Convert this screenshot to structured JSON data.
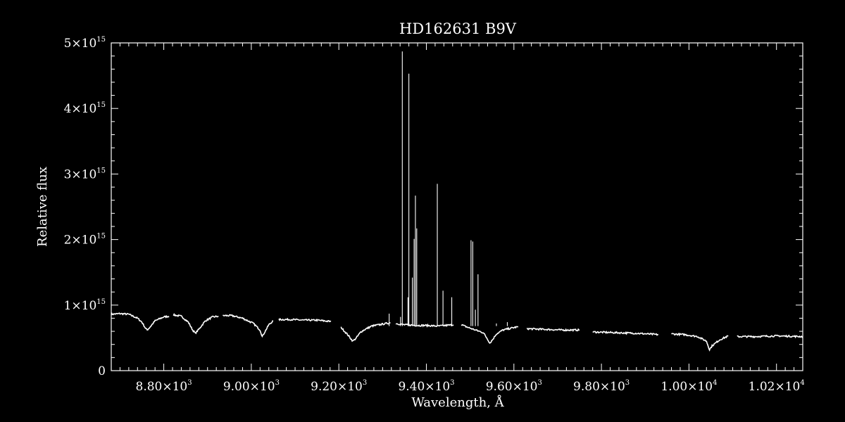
{
  "chart_data": {
    "type": "line",
    "title": "HD162631   B9V",
    "xlabel": "Wavelength, Å",
    "ylabel": "Relative flux",
    "xlim": [
      8680,
      10260
    ],
    "ylim": [
      0,
      5000000000000000.0
    ],
    "grid": false,
    "x_ticks": [
      {
        "value": 8800,
        "mantissa": "8.80×10",
        "exp": "3"
      },
      {
        "value": 9000,
        "mantissa": "9.00×10",
        "exp": "3"
      },
      {
        "value": 9200,
        "mantissa": "9.20×10",
        "exp": "3"
      },
      {
        "value": 9400,
        "mantissa": "9.40×10",
        "exp": "3"
      },
      {
        "value": 9600,
        "mantissa": "9.60×10",
        "exp": "3"
      },
      {
        "value": 9800,
        "mantissa": "9.80×10",
        "exp": "3"
      },
      {
        "value": 10000,
        "mantissa": "1.00×10",
        "exp": "4"
      },
      {
        "value": 10200,
        "mantissa": "1.02×10",
        "exp": "4"
      }
    ],
    "y_ticks": [
      {
        "value": 0,
        "mantissa": "0",
        "exp": ""
      },
      {
        "value": 1000000000000000.0,
        "mantissa": "1×10",
        "exp": "15"
      },
      {
        "value": 2000000000000000.0,
        "mantissa": "2×10",
        "exp": "15"
      },
      {
        "value": 3000000000000000.0,
        "mantissa": "3×10",
        "exp": "15"
      },
      {
        "value": 4000000000000000.0,
        "mantissa": "4×10",
        "exp": "15"
      },
      {
        "value": 5000000000000000.0,
        "mantissa": "5×10",
        "exp": "15"
      }
    ],
    "series": [
      {
        "points": [
          [
            8680,
            0.86
          ],
          [
            8700,
            0.87
          ],
          [
            8720,
            0.86
          ],
          [
            8740,
            0.8
          ],
          [
            8750,
            0.74
          ],
          [
            8758,
            0.65
          ],
          [
            8762,
            0.62
          ],
          [
            8768,
            0.66
          ],
          [
            8780,
            0.76
          ],
          [
            8800,
            0.82
          ],
          [
            8812,
            0.83
          ]
        ]
      },
      {
        "points": [
          [
            8822,
            0.85
          ],
          [
            8840,
            0.83
          ],
          [
            8856,
            0.74
          ],
          [
            8866,
            0.62
          ],
          [
            8872,
            0.57
          ],
          [
            8880,
            0.63
          ],
          [
            8895,
            0.76
          ],
          [
            8912,
            0.82
          ],
          [
            8925,
            0.83
          ]
        ]
      },
      {
        "points": [
          [
            8935,
            0.84
          ],
          [
            8955,
            0.84
          ],
          [
            8980,
            0.8
          ],
          [
            9005,
            0.72
          ],
          [
            9020,
            0.62
          ],
          [
            9025,
            0.52
          ],
          [
            9030,
            0.58
          ],
          [
            9040,
            0.7
          ],
          [
            9050,
            0.76
          ]
        ]
      },
      {
        "points": [
          [
            9063,
            0.78
          ],
          [
            9090,
            0.78
          ],
          [
            9120,
            0.77
          ],
          [
            9150,
            0.77
          ],
          [
            9182,
            0.75
          ]
        ]
      },
      {
        "points": [
          [
            9205,
            0.66
          ],
          [
            9220,
            0.55
          ],
          [
            9232,
            0.45
          ],
          [
            9240,
            0.5
          ],
          [
            9250,
            0.59
          ],
          [
            9260,
            0.63
          ],
          [
            9275,
            0.68
          ],
          [
            9300,
            0.71
          ],
          [
            9318,
            0.73
          ]
        ]
      },
      {
        "points": [
          [
            9330,
            0.72
          ],
          [
            9350,
            0.7
          ],
          [
            9380,
            0.69
          ],
          [
            9400,
            0.69
          ],
          [
            9425,
            0.68
          ],
          [
            9445,
            0.69
          ],
          [
            9462,
            0.7
          ]
        ]
      },
      {
        "points": [
          [
            9480,
            0.7
          ],
          [
            9495,
            0.66
          ],
          [
            9512,
            0.62
          ],
          [
            9530,
            0.58
          ],
          [
            9540,
            0.48
          ],
          [
            9545,
            0.42
          ],
          [
            9552,
            0.48
          ],
          [
            9560,
            0.56
          ],
          [
            9575,
            0.62
          ],
          [
            9595,
            0.65
          ],
          [
            9610,
            0.67
          ]
        ]
      },
      {
        "points": [
          [
            9630,
            0.64
          ],
          [
            9670,
            0.63
          ],
          [
            9710,
            0.62
          ],
          [
            9750,
            0.62
          ]
        ]
      },
      {
        "points": [
          [
            9780,
            0.59
          ],
          [
            9830,
            0.58
          ],
          [
            9880,
            0.57
          ],
          [
            9930,
            0.55
          ]
        ]
      },
      {
        "points": [
          [
            9960,
            0.56
          ],
          [
            9990,
            0.55
          ],
          [
            10020,
            0.52
          ],
          [
            10040,
            0.45
          ],
          [
            10047,
            0.32
          ],
          [
            10053,
            0.38
          ],
          [
            10070,
            0.47
          ],
          [
            10090,
            0.53
          ]
        ]
      },
      {
        "points": [
          [
            10110,
            0.52
          ],
          [
            10150,
            0.52
          ],
          [
            10200,
            0.53
          ],
          [
            10260,
            0.52
          ]
        ]
      }
    ],
    "spikes": [
      [
        9315,
        0.87
      ],
      [
        9341,
        0.82
      ],
      [
        9345,
        4.87
      ],
      [
        9358,
        1.12
      ],
      [
        9360,
        4.53
      ],
      [
        9368,
        1.42
      ],
      [
        9372,
        2.01
      ],
      [
        9375,
        2.67
      ],
      [
        9378,
        2.17
      ],
      [
        9425,
        2.85
      ],
      [
        9438,
        1.22
      ],
      [
        9458,
        1.12
      ],
      [
        9502,
        1.99
      ],
      [
        9506,
        1.97
      ],
      [
        9512,
        0.93
      ],
      [
        9518,
        1.47
      ],
      [
        9560,
        0.72
      ],
      [
        9585,
        0.74
      ]
    ]
  }
}
